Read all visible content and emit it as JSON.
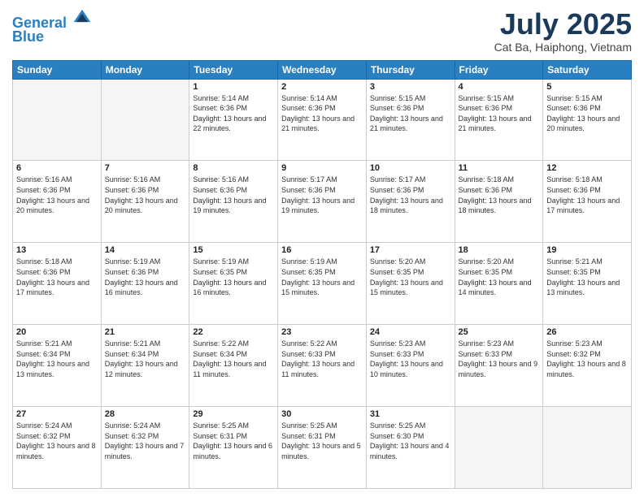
{
  "header": {
    "logo_line1": "General",
    "logo_line2": "Blue",
    "month": "July 2025",
    "location": "Cat Ba, Haiphong, Vietnam"
  },
  "weekdays": [
    "Sunday",
    "Monday",
    "Tuesday",
    "Wednesday",
    "Thursday",
    "Friday",
    "Saturday"
  ],
  "weeks": [
    [
      {
        "day": "",
        "empty": true
      },
      {
        "day": "",
        "empty": true
      },
      {
        "day": "1",
        "rise": "5:14 AM",
        "set": "6:36 PM",
        "daylight": "13 hours and 22 minutes."
      },
      {
        "day": "2",
        "rise": "5:14 AM",
        "set": "6:36 PM",
        "daylight": "13 hours and 21 minutes."
      },
      {
        "day": "3",
        "rise": "5:15 AM",
        "set": "6:36 PM",
        "daylight": "13 hours and 21 minutes."
      },
      {
        "day": "4",
        "rise": "5:15 AM",
        "set": "6:36 PM",
        "daylight": "13 hours and 21 minutes."
      },
      {
        "day": "5",
        "rise": "5:15 AM",
        "set": "6:36 PM",
        "daylight": "13 hours and 20 minutes."
      }
    ],
    [
      {
        "day": "6",
        "rise": "5:16 AM",
        "set": "6:36 PM",
        "daylight": "13 hours and 20 minutes."
      },
      {
        "day": "7",
        "rise": "5:16 AM",
        "set": "6:36 PM",
        "daylight": "13 hours and 20 minutes."
      },
      {
        "day": "8",
        "rise": "5:16 AM",
        "set": "6:36 PM",
        "daylight": "13 hours and 19 minutes."
      },
      {
        "day": "9",
        "rise": "5:17 AM",
        "set": "6:36 PM",
        "daylight": "13 hours and 19 minutes."
      },
      {
        "day": "10",
        "rise": "5:17 AM",
        "set": "6:36 PM",
        "daylight": "13 hours and 18 minutes."
      },
      {
        "day": "11",
        "rise": "5:18 AM",
        "set": "6:36 PM",
        "daylight": "13 hours and 18 minutes."
      },
      {
        "day": "12",
        "rise": "5:18 AM",
        "set": "6:36 PM",
        "daylight": "13 hours and 17 minutes."
      }
    ],
    [
      {
        "day": "13",
        "rise": "5:18 AM",
        "set": "6:36 PM",
        "daylight": "13 hours and 17 minutes."
      },
      {
        "day": "14",
        "rise": "5:19 AM",
        "set": "6:36 PM",
        "daylight": "13 hours and 16 minutes."
      },
      {
        "day": "15",
        "rise": "5:19 AM",
        "set": "6:35 PM",
        "daylight": "13 hours and 16 minutes."
      },
      {
        "day": "16",
        "rise": "5:19 AM",
        "set": "6:35 PM",
        "daylight": "13 hours and 15 minutes."
      },
      {
        "day": "17",
        "rise": "5:20 AM",
        "set": "6:35 PM",
        "daylight": "13 hours and 15 minutes."
      },
      {
        "day": "18",
        "rise": "5:20 AM",
        "set": "6:35 PM",
        "daylight": "13 hours and 14 minutes."
      },
      {
        "day": "19",
        "rise": "5:21 AM",
        "set": "6:35 PM",
        "daylight": "13 hours and 13 minutes."
      }
    ],
    [
      {
        "day": "20",
        "rise": "5:21 AM",
        "set": "6:34 PM",
        "daylight": "13 hours and 13 minutes."
      },
      {
        "day": "21",
        "rise": "5:21 AM",
        "set": "6:34 PM",
        "daylight": "13 hours and 12 minutes."
      },
      {
        "day": "22",
        "rise": "5:22 AM",
        "set": "6:34 PM",
        "daylight": "13 hours and 11 minutes."
      },
      {
        "day": "23",
        "rise": "5:22 AM",
        "set": "6:33 PM",
        "daylight": "13 hours and 11 minutes."
      },
      {
        "day": "24",
        "rise": "5:23 AM",
        "set": "6:33 PM",
        "daylight": "13 hours and 10 minutes."
      },
      {
        "day": "25",
        "rise": "5:23 AM",
        "set": "6:33 PM",
        "daylight": "13 hours and 9 minutes."
      },
      {
        "day": "26",
        "rise": "5:23 AM",
        "set": "6:32 PM",
        "daylight": "13 hours and 8 minutes."
      }
    ],
    [
      {
        "day": "27",
        "rise": "5:24 AM",
        "set": "6:32 PM",
        "daylight": "13 hours and 8 minutes."
      },
      {
        "day": "28",
        "rise": "5:24 AM",
        "set": "6:32 PM",
        "daylight": "13 hours and 7 minutes."
      },
      {
        "day": "29",
        "rise": "5:25 AM",
        "set": "6:31 PM",
        "daylight": "13 hours and 6 minutes."
      },
      {
        "day": "30",
        "rise": "5:25 AM",
        "set": "6:31 PM",
        "daylight": "13 hours and 5 minutes."
      },
      {
        "day": "31",
        "rise": "5:25 AM",
        "set": "6:30 PM",
        "daylight": "13 hours and 4 minutes."
      },
      {
        "day": "",
        "empty": true
      },
      {
        "day": "",
        "empty": true
      }
    ]
  ]
}
